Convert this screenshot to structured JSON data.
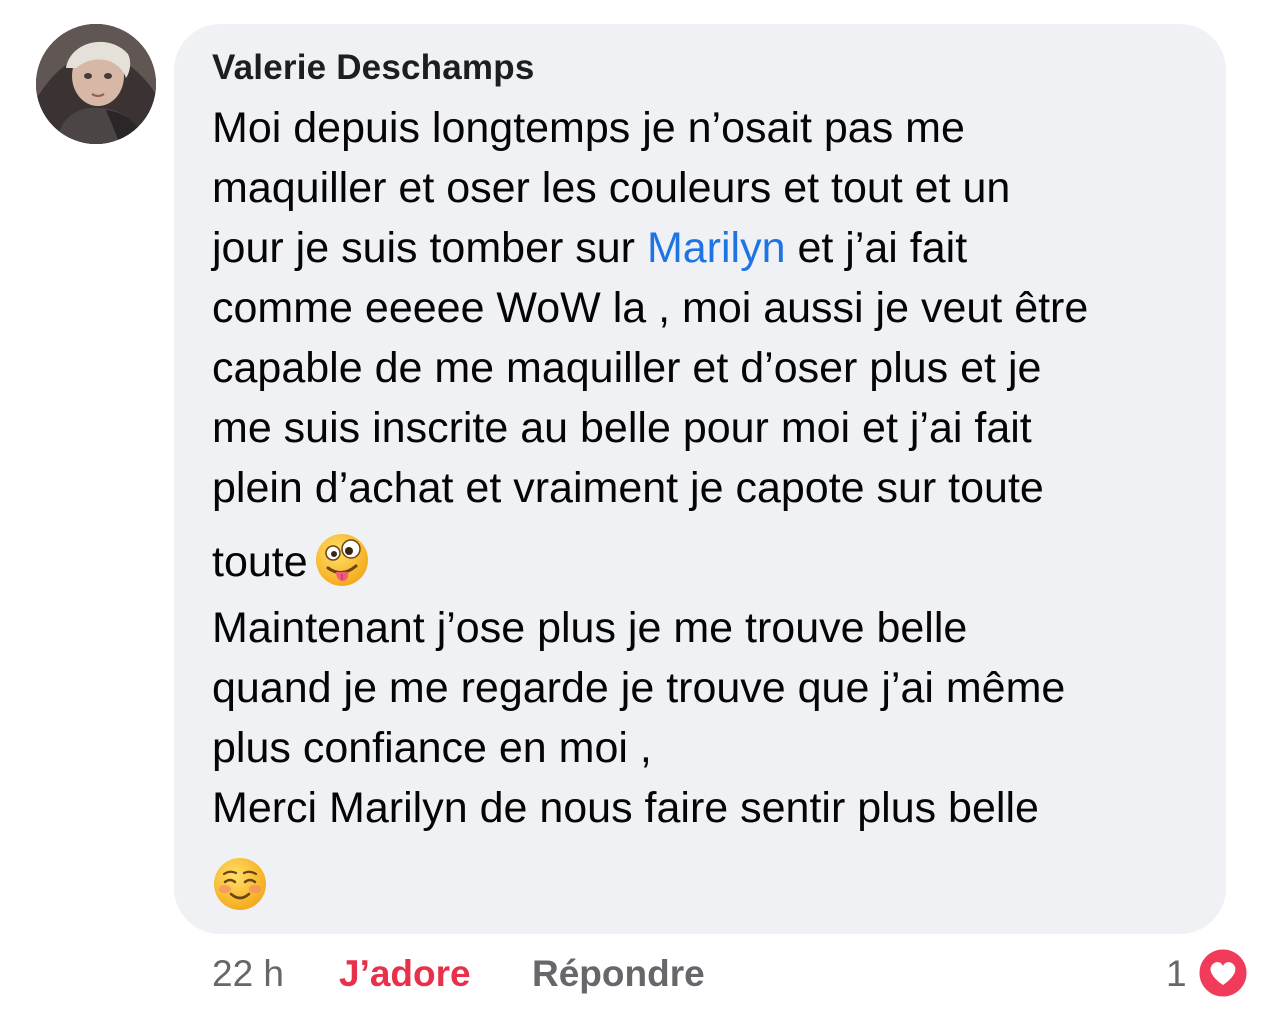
{
  "comment": {
    "author": "Valerie Deschamps",
    "lines": {
      "l1": "Moi depuis longtemps je n’osait pas me",
      "l2": "maquiller et oser les couleurs et tout et un",
      "l3_before": "jour je suis tomber sur ",
      "l3_mention": "Marilyn",
      "l3_after": " et j’ai fait",
      "l4": "comme eeeee WoW la , moi aussi je veut être",
      "l5": "capable de me maquiller et d’oser plus et je",
      "l6": "me suis inscrite au belle pour moi et j’ai fait",
      "l7": "plein d’achat et vraiment je capote sur toute",
      "l8": "toute",
      "l9": "Maintenant j’ose plus je me trouve belle",
      "l10": "quand je me regarde je trouve que j’ai même",
      "l11": "plus confiance en moi ,",
      "l12": "Merci Marilyn de nous faire sentir plus belle"
    },
    "emojis": [
      "zany-face-emoji",
      "smiling-face-emoji"
    ]
  },
  "footer": {
    "time": "22 h",
    "reaction_label": "J’adore",
    "reply_label": "Répondre",
    "reaction_count": "1",
    "reaction_icon": "heart-icon"
  },
  "colors": {
    "bubble": "#f0f1f5",
    "mention": "#1f74e4",
    "reaction": "#e8304a",
    "meta": "#65676b"
  }
}
